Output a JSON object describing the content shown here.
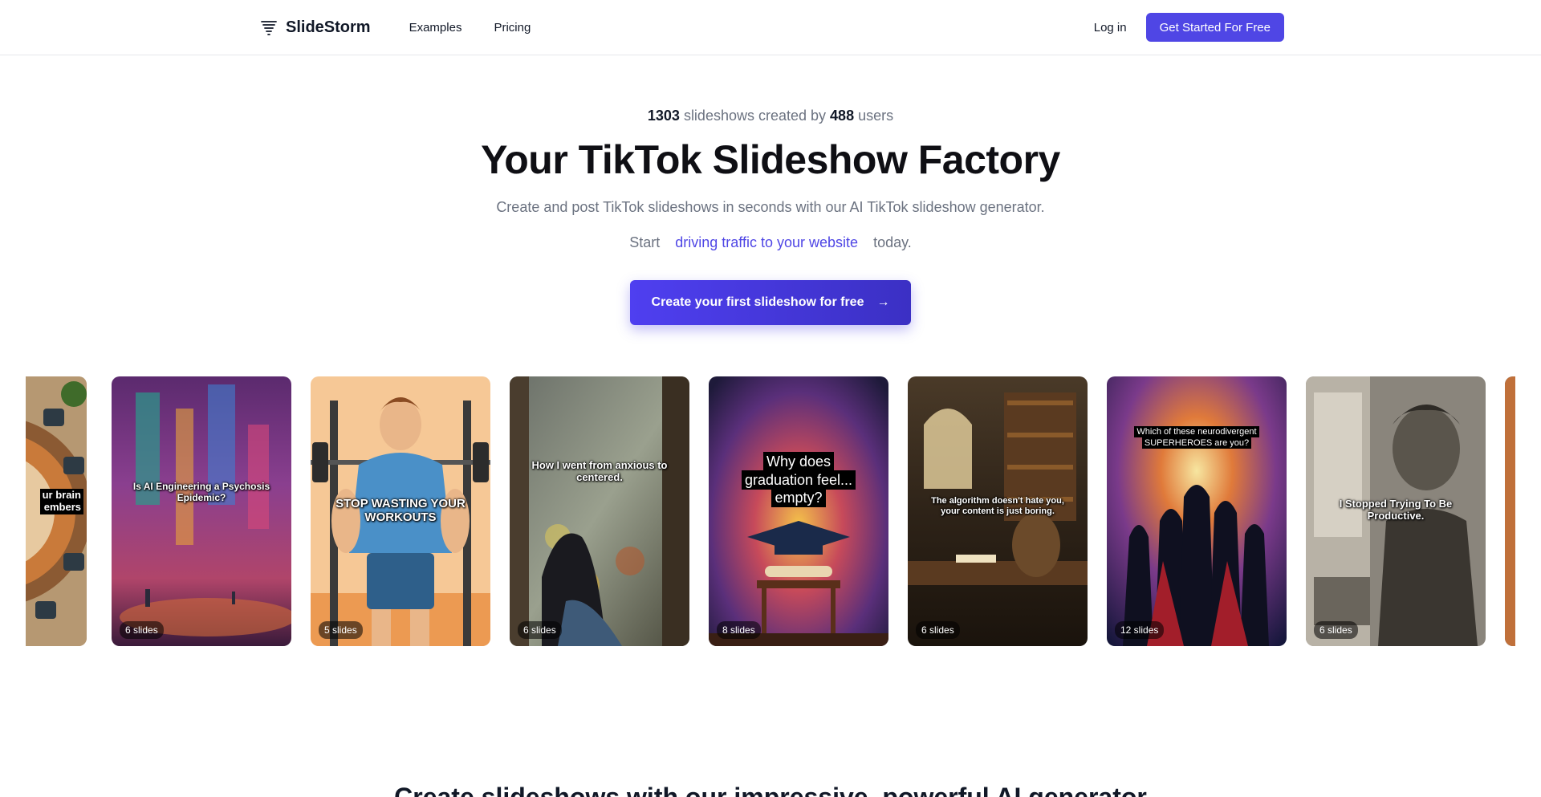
{
  "nav": {
    "brand": "SlideStorm",
    "links": [
      "Examples",
      "Pricing"
    ],
    "login": "Log in",
    "cta": "Get Started For Free"
  },
  "hero": {
    "stats_count_slideshows": "1303",
    "stats_mid": "slideshows created by",
    "stats_count_users": "488",
    "stats_end": "users",
    "title": "Your TikTok Slideshow Factory",
    "subtitle": "Create and post TikTok slideshows in seconds with our AI TikTok slideshow generator.",
    "start_word": "Start",
    "start_link": "driving traffic to your website",
    "start_end": "today.",
    "cta": "Create your first slideshow for free",
    "cta_icon": "arrow-right-icon"
  },
  "carousel": {
    "cards": [
      {
        "caption": "ur brain\nembers",
        "slides": ""
      },
      {
        "caption": "Is AI Engineering a Psychosis Epidemic?",
        "slides": "6 slides"
      },
      {
        "caption": "STOP WASTING YOUR WORKOUTS",
        "slides": "5 slides"
      },
      {
        "caption": "How I went from anxious to centered.",
        "slides": "6 slides"
      },
      {
        "caption": "Why does graduation feel... empty?",
        "slides": "8 slides"
      },
      {
        "caption": "The algorithm doesn't hate you, your content is just boring.",
        "slides": "6 slides"
      },
      {
        "caption": "Which of these neurodivergent SUPERHEROES are you?",
        "slides": "12 slides"
      },
      {
        "caption": "I Stopped Trying To Be Productive.",
        "slides": "6 slides"
      },
      {
        "caption": "",
        "slides": ""
      }
    ]
  },
  "section": {
    "heading": "Create slideshows with our impressive, powerful AI generator"
  },
  "colors": {
    "accent": "#4f46e5",
    "text": "#111827",
    "muted": "#6b7280"
  }
}
